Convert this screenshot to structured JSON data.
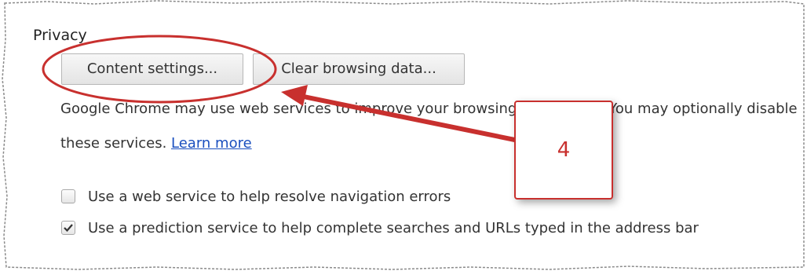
{
  "section": {
    "title": "Privacy"
  },
  "buttons": {
    "content_settings": "Content settings...",
    "clear_browsing_data": "Clear browsing data..."
  },
  "description": {
    "line1": "Google Chrome may use web services to improve your browsing experience. You may optionally disable",
    "line2_prefix": "these services. ",
    "learn_more": "Learn more"
  },
  "options": [
    {
      "label": "Use a web service to help resolve navigation errors",
      "checked": false
    },
    {
      "label": "Use a prediction service to help complete searches and URLs typed in the address bar",
      "checked": true
    }
  ],
  "annotation": {
    "step_number": "4",
    "color": "#c8302e"
  },
  "icons": {
    "check": "checkmark-icon"
  }
}
